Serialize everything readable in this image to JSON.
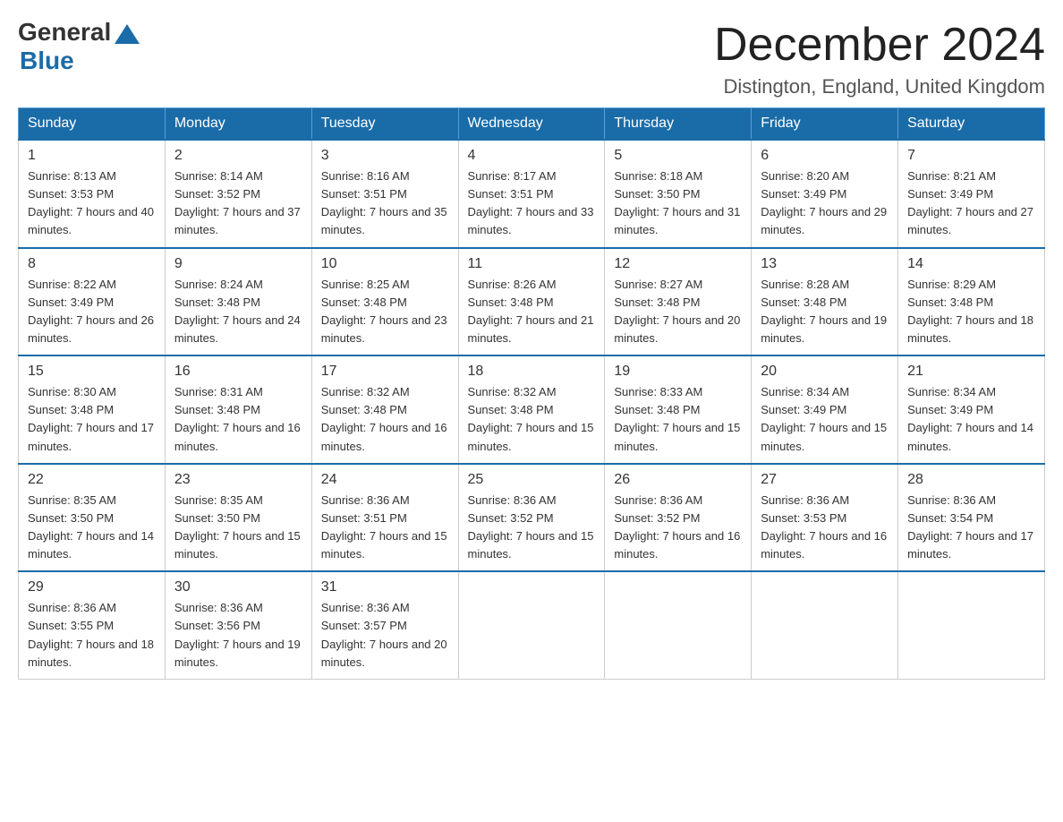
{
  "logo": {
    "general": "General",
    "blue": "Blue"
  },
  "header": {
    "month": "December 2024",
    "location": "Distington, England, United Kingdom"
  },
  "weekdays": [
    "Sunday",
    "Monday",
    "Tuesday",
    "Wednesday",
    "Thursday",
    "Friday",
    "Saturday"
  ],
  "weeks": [
    [
      {
        "day": "1",
        "sunrise": "8:13 AM",
        "sunset": "3:53 PM",
        "daylight": "7 hours and 40 minutes."
      },
      {
        "day": "2",
        "sunrise": "8:14 AM",
        "sunset": "3:52 PM",
        "daylight": "7 hours and 37 minutes."
      },
      {
        "day": "3",
        "sunrise": "8:16 AM",
        "sunset": "3:51 PM",
        "daylight": "7 hours and 35 minutes."
      },
      {
        "day": "4",
        "sunrise": "8:17 AM",
        "sunset": "3:51 PM",
        "daylight": "7 hours and 33 minutes."
      },
      {
        "day": "5",
        "sunrise": "8:18 AM",
        "sunset": "3:50 PM",
        "daylight": "7 hours and 31 minutes."
      },
      {
        "day": "6",
        "sunrise": "8:20 AM",
        "sunset": "3:49 PM",
        "daylight": "7 hours and 29 minutes."
      },
      {
        "day": "7",
        "sunrise": "8:21 AM",
        "sunset": "3:49 PM",
        "daylight": "7 hours and 27 minutes."
      }
    ],
    [
      {
        "day": "8",
        "sunrise": "8:22 AM",
        "sunset": "3:49 PM",
        "daylight": "7 hours and 26 minutes."
      },
      {
        "day": "9",
        "sunrise": "8:24 AM",
        "sunset": "3:48 PM",
        "daylight": "7 hours and 24 minutes."
      },
      {
        "day": "10",
        "sunrise": "8:25 AM",
        "sunset": "3:48 PM",
        "daylight": "7 hours and 23 minutes."
      },
      {
        "day": "11",
        "sunrise": "8:26 AM",
        "sunset": "3:48 PM",
        "daylight": "7 hours and 21 minutes."
      },
      {
        "day": "12",
        "sunrise": "8:27 AM",
        "sunset": "3:48 PM",
        "daylight": "7 hours and 20 minutes."
      },
      {
        "day": "13",
        "sunrise": "8:28 AM",
        "sunset": "3:48 PM",
        "daylight": "7 hours and 19 minutes."
      },
      {
        "day": "14",
        "sunrise": "8:29 AM",
        "sunset": "3:48 PM",
        "daylight": "7 hours and 18 minutes."
      }
    ],
    [
      {
        "day": "15",
        "sunrise": "8:30 AM",
        "sunset": "3:48 PM",
        "daylight": "7 hours and 17 minutes."
      },
      {
        "day": "16",
        "sunrise": "8:31 AM",
        "sunset": "3:48 PM",
        "daylight": "7 hours and 16 minutes."
      },
      {
        "day": "17",
        "sunrise": "8:32 AM",
        "sunset": "3:48 PM",
        "daylight": "7 hours and 16 minutes."
      },
      {
        "day": "18",
        "sunrise": "8:32 AM",
        "sunset": "3:48 PM",
        "daylight": "7 hours and 15 minutes."
      },
      {
        "day": "19",
        "sunrise": "8:33 AM",
        "sunset": "3:48 PM",
        "daylight": "7 hours and 15 minutes."
      },
      {
        "day": "20",
        "sunrise": "8:34 AM",
        "sunset": "3:49 PM",
        "daylight": "7 hours and 15 minutes."
      },
      {
        "day": "21",
        "sunrise": "8:34 AM",
        "sunset": "3:49 PM",
        "daylight": "7 hours and 14 minutes."
      }
    ],
    [
      {
        "day": "22",
        "sunrise": "8:35 AM",
        "sunset": "3:50 PM",
        "daylight": "7 hours and 14 minutes."
      },
      {
        "day": "23",
        "sunrise": "8:35 AM",
        "sunset": "3:50 PM",
        "daylight": "7 hours and 15 minutes."
      },
      {
        "day": "24",
        "sunrise": "8:36 AM",
        "sunset": "3:51 PM",
        "daylight": "7 hours and 15 minutes."
      },
      {
        "day": "25",
        "sunrise": "8:36 AM",
        "sunset": "3:52 PM",
        "daylight": "7 hours and 15 minutes."
      },
      {
        "day": "26",
        "sunrise": "8:36 AM",
        "sunset": "3:52 PM",
        "daylight": "7 hours and 16 minutes."
      },
      {
        "day": "27",
        "sunrise": "8:36 AM",
        "sunset": "3:53 PM",
        "daylight": "7 hours and 16 minutes."
      },
      {
        "day": "28",
        "sunrise": "8:36 AM",
        "sunset": "3:54 PM",
        "daylight": "7 hours and 17 minutes."
      }
    ],
    [
      {
        "day": "29",
        "sunrise": "8:36 AM",
        "sunset": "3:55 PM",
        "daylight": "7 hours and 18 minutes."
      },
      {
        "day": "30",
        "sunrise": "8:36 AM",
        "sunset": "3:56 PM",
        "daylight": "7 hours and 19 minutes."
      },
      {
        "day": "31",
        "sunrise": "8:36 AM",
        "sunset": "3:57 PM",
        "daylight": "7 hours and 20 minutes."
      },
      null,
      null,
      null,
      null
    ]
  ]
}
